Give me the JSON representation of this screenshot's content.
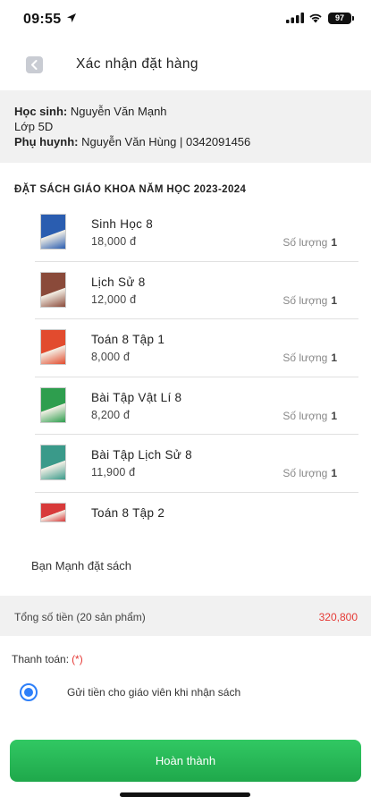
{
  "status_bar": {
    "time": "09:55",
    "battery": "97"
  },
  "nav": {
    "title": "Xác nhận đặt hàng"
  },
  "student": {
    "student_label": "Học sinh:",
    "student_name": "Nguyễn Văn Mạnh",
    "class_line": "Lớp 5D",
    "parent_label": "Phụ huynh:",
    "parent_info": "Nguyễn Văn Hùng | 0342091456"
  },
  "section_title": "ĐẶT SÁCH GIÁO KHOA NĂM HỌC 2023-2024",
  "qty_label": "Số lượng",
  "books": [
    {
      "name": "Sinh Học 8",
      "price": "18,000 đ",
      "qty": "1",
      "cover_color": "#2a5db0"
    },
    {
      "name": "Lịch Sử 8",
      "price": "12,000 đ",
      "qty": "1",
      "cover_color": "#8a4a3a"
    },
    {
      "name": "Toán 8 Tập 1",
      "price": "8,000 đ",
      "qty": "1",
      "cover_color": "#e24b2e"
    },
    {
      "name": "Bài Tập Vật Lí 8",
      "price": "8,200 đ",
      "qty": "1",
      "cover_color": "#2e9e4e"
    },
    {
      "name": "Bài Tập Lịch Sử 8",
      "price": "11,900 đ",
      "qty": "1",
      "cover_color": "#3a9a8a"
    },
    {
      "name": "Toán 8 Tập 2",
      "price": "",
      "qty": "",
      "cover_color": "#d83a3a"
    }
  ],
  "orderer_text": "Bạn Mạnh đặt sách",
  "total": {
    "label": "Tổng số tiền (20 sản phẩm)",
    "value": "320,800"
  },
  "payment": {
    "label": "Thanh toán:",
    "required_mark": "(*)",
    "option": "Gửi tiền cho giáo viên khi nhận sách"
  },
  "complete_button": "Hoàn thành"
}
